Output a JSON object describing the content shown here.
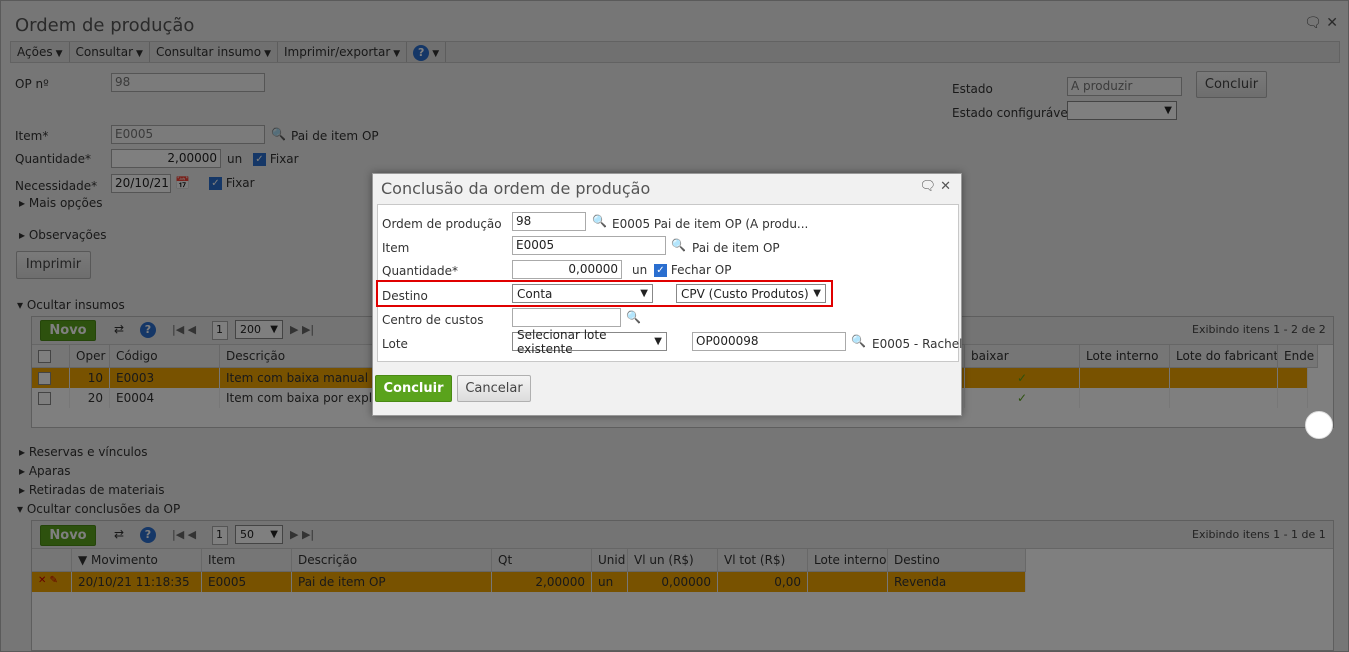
{
  "window": {
    "title": "Ordem de produção"
  },
  "menu": [
    "Ações",
    "Consultar",
    "Consultar insumo",
    "Imprimir/exportar"
  ],
  "form": {
    "op_label": "OP nº",
    "op_value": "98",
    "item_label": "Item*",
    "item_value": "E0005",
    "item_desc": "Pai de item OP",
    "qtd_label": "Quantidade*",
    "qtd_value": "2,00000",
    "qtd_unit": "un",
    "fixar": "Fixar",
    "nec_label": "Necessidade*",
    "nec_value": "20/10/21",
    "fixar2": "Fixar",
    "mais": "Mais opções",
    "obs": "Observações",
    "imprimir": "Imprimir",
    "estado_label": "Estado",
    "estado_value": "A produzir",
    "concluir": "Concluir",
    "estado_conf_label": "Estado configurável"
  },
  "insumos": {
    "section": "Ocultar insumos",
    "novo": "Novo",
    "page": "1",
    "per_page": "200",
    "info": "Exibindo itens 1 - 2 de 2",
    "headers": [
      "Oper",
      "Código",
      "Descrição",
      "baixar",
      "Lote interno",
      "Lote do fabricante",
      "Ende"
    ],
    "rows": [
      {
        "oper": "10",
        "codigo": "E0003",
        "desc": "Item com baixa manual (Li"
      },
      {
        "oper": "20",
        "codigo": "E0004",
        "desc": "Item com baixa por explos"
      }
    ]
  },
  "sections": [
    "Reservas e vínculos",
    "Aparas",
    "Retiradas de materiais",
    "Ocultar conclusões da OP"
  ],
  "conclusoes": {
    "novo": "Novo",
    "page": "1",
    "per_page": "50",
    "info": "Exibindo itens 1 - 1 de 1",
    "headers": [
      "Movimento",
      "Item",
      "Descrição",
      "Qt",
      "Unid",
      "Vl un (R$)",
      "Vl tot (R$)",
      "Lote interno",
      "Destino"
    ],
    "row": {
      "mov": "20/10/21 11:18:35",
      "item": "E0005",
      "desc": "Pai de item OP",
      "qt": "2,00000",
      "unid": "un",
      "vlun": "0,00000",
      "vltot": "0,00",
      "lote": "",
      "destino": "Revenda"
    }
  },
  "dialog": {
    "title": "Conclusão da ordem de produção",
    "op_label": "Ordem de produção",
    "op_value": "98",
    "op_desc": "E0005 Pai de item OP (A produ...",
    "item_label": "Item",
    "item_value": "E0005",
    "item_desc": "Pai de item OP",
    "qtd_label": "Quantidade*",
    "qtd_value": "0,00000",
    "qtd_unit": "un",
    "fechar": "Fechar OP",
    "destino_label": "Destino",
    "destino_value": "Conta",
    "destino_value2": "CPV (Custo Produtos)",
    "cc_label": "Centro de custos",
    "lote_label": "Lote",
    "lote_select": "Selecionar lote existente",
    "lote_value": "OP000098",
    "lote_desc": "E0005 - Rachel",
    "concluir": "Concluir",
    "cancelar": "Cancelar"
  }
}
